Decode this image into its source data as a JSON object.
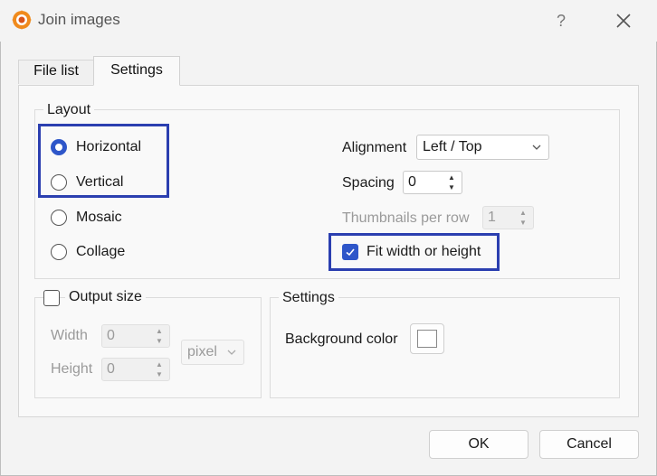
{
  "window": {
    "title": "Join images",
    "help": "?"
  },
  "icons": {
    "app": "xnview-app-icon",
    "close": "close-icon",
    "chevron": "chevron-down-icon",
    "check": "check-icon"
  },
  "tabs": [
    {
      "label": "File list",
      "active": false
    },
    {
      "label": "Settings",
      "active": true
    }
  ],
  "layout": {
    "title": "Layout",
    "options": [
      {
        "label": "Horizontal",
        "checked": true
      },
      {
        "label": "Vertical",
        "checked": false
      },
      {
        "label": "Mosaic",
        "checked": false
      },
      {
        "label": "Collage",
        "checked": false
      }
    ],
    "alignment_label": "Alignment",
    "alignment_value": "Left / Top",
    "spacing_label": "Spacing",
    "spacing_value": "0",
    "thumbs_label": "Thumbnails per row",
    "thumbs_value": "1",
    "fit_label": "Fit width or height",
    "fit_checked": true
  },
  "output": {
    "title": "Output size",
    "checked": false,
    "width_label": "Width",
    "width_value": "0",
    "height_label": "Height",
    "height_value": "0",
    "unit": "pixel"
  },
  "settings": {
    "title": "Settings",
    "bg_label": "Background color",
    "bg_color": "#ffffff"
  },
  "buttons": {
    "ok": "OK",
    "cancel": "Cancel"
  },
  "colors": {
    "accent": "#2e56c9",
    "highlight": "#2b3fb0"
  }
}
